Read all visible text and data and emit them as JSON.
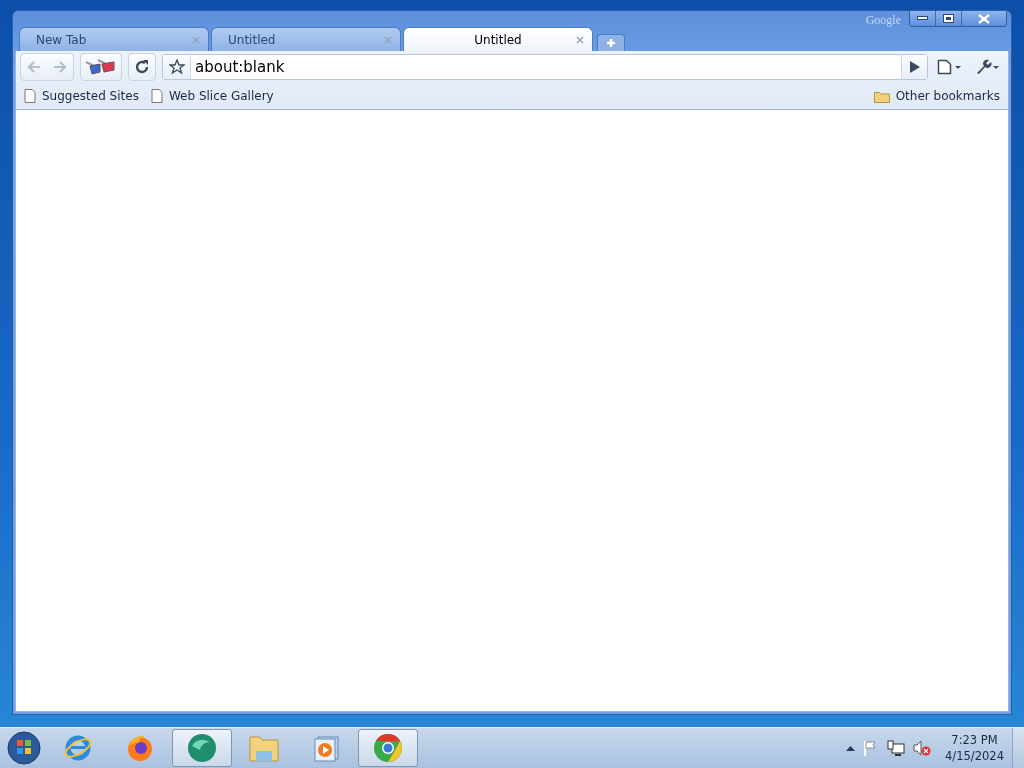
{
  "window": {
    "brand": "Google"
  },
  "tabs": [
    {
      "label": "New Tab",
      "selected": false
    },
    {
      "label": "Untitled",
      "selected": false
    },
    {
      "label": "Untitled",
      "selected": true
    }
  ],
  "toolbar": {
    "back": {
      "disabled": true
    },
    "forward": {
      "disabled": true
    },
    "address": "about:blank"
  },
  "bookmarks": [
    {
      "label": "Suggested Sites",
      "kind": "page"
    },
    {
      "label": "Web Slice Gallery",
      "kind": "page"
    }
  ],
  "other_bookmarks": {
    "label": "Other bookmarks",
    "kind": "folder"
  },
  "taskbar": {
    "apps": [
      {
        "kind": "ie",
        "active": false
      },
      {
        "kind": "firefox",
        "active": false
      },
      {
        "kind": "green",
        "active": true
      },
      {
        "kind": "folder",
        "active": false
      },
      {
        "kind": "media",
        "active": false
      },
      {
        "kind": "chrome",
        "active": true
      }
    ],
    "time": "7:23 PM",
    "date": "4/15/2024"
  }
}
